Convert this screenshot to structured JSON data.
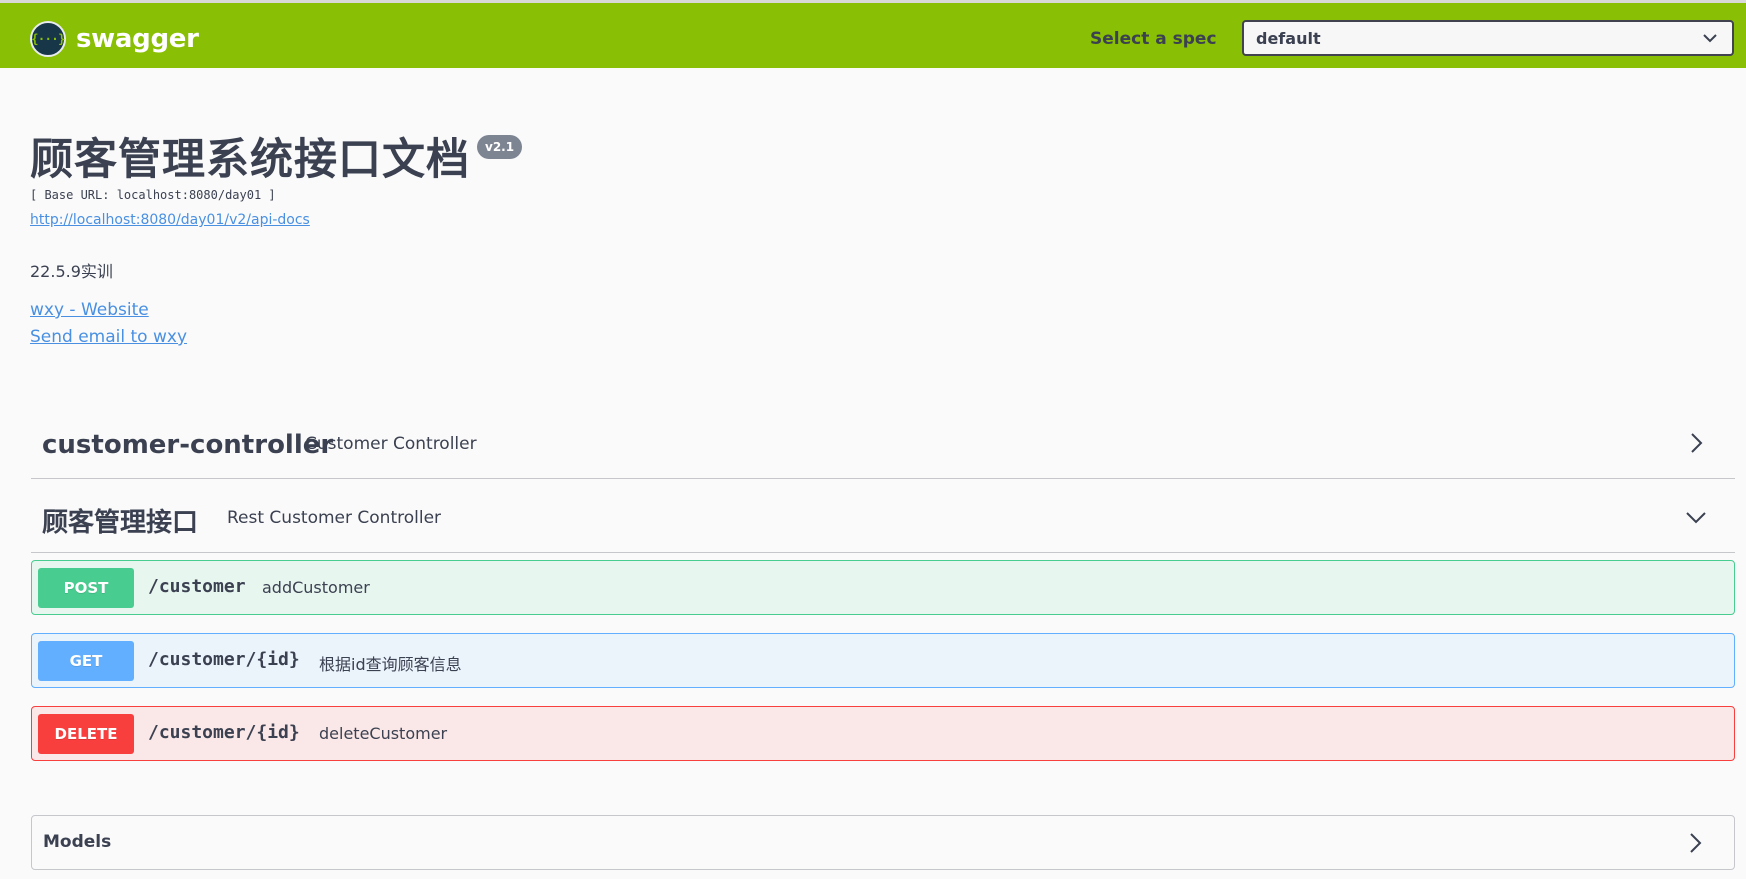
{
  "topbar": {
    "logo_glyph": "{···}",
    "logo_text": "swagger",
    "spec_label": "Select a spec",
    "spec_selected": "default",
    "background_color": "#89bf04"
  },
  "info": {
    "title": "顾客管理系统接口文档",
    "version": "v2.1",
    "base_url": "[ Base URL: localhost:8080/day01 ]",
    "api_docs_url": "http://localhost:8080/day01/v2/api-docs",
    "description": "22.5.9实训",
    "contact_website": "wxy - Website",
    "contact_email": "Send email to wxy"
  },
  "tags": [
    {
      "name": "customer-controller",
      "description": "Customer Controller",
      "state": "collapsed"
    },
    {
      "name": "顾客管理接口",
      "description": "Rest Customer Controller",
      "state": "expanded"
    }
  ],
  "operations": [
    {
      "method": "POST",
      "path": "/customer",
      "summary": "addCustomer",
      "color": "#49cc90"
    },
    {
      "method": "GET",
      "path": "/customer/{id}",
      "summary": "根据id查询顾客信息",
      "color": "#61affe"
    },
    {
      "method": "DELETE",
      "path": "/customer/{id}",
      "summary": "deleteCustomer",
      "color": "#f93e3e"
    }
  ],
  "models": {
    "title": "Models",
    "state": "collapsed"
  },
  "icons": {
    "spec_dropdown": "chevron-down-icon",
    "tag_collapsed": "chevron-right-icon",
    "tag_expanded": "chevron-down-icon",
    "models": "chevron-right-icon"
  }
}
